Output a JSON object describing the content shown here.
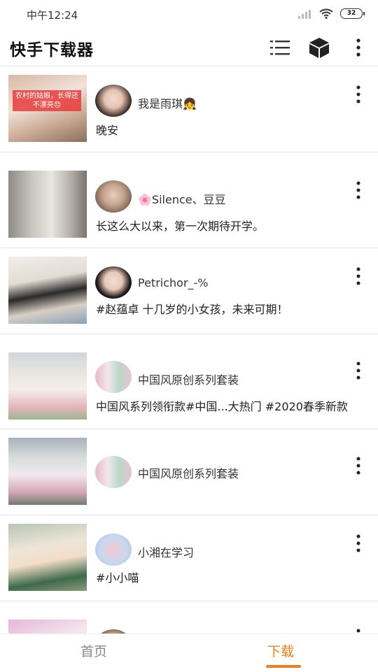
{
  "status_bar": {
    "time": "中午12:24",
    "battery": "32"
  },
  "app_bar": {
    "title": "快手下载器"
  },
  "thumb_caption": "农村的姑娘，长得还不漂亮😞",
  "items": [
    {
      "name": "我是雨琪👧",
      "desc": "晚安"
    },
    {
      "name": "🌸Silence、豆豆",
      "desc": "长这么大以来，第一次期待开学。"
    },
    {
      "name": "Petrichor_-%",
      "desc": "#赵蕴卓 十几岁的小女孩，未来可期！"
    },
    {
      "name": "中国风原创系列套装",
      "desc": "中国风系列领衔款#中国...大热门 #2020春季新款"
    },
    {
      "name": "中国风原创系列套装",
      "desc": ""
    },
    {
      "name": "小湘在学习",
      "desc": "#小小喵"
    },
    {
      "name": "",
      "desc": ""
    }
  ],
  "bottom_nav": {
    "home": "首页",
    "download": "下载",
    "accent": "#f07d1a"
  }
}
